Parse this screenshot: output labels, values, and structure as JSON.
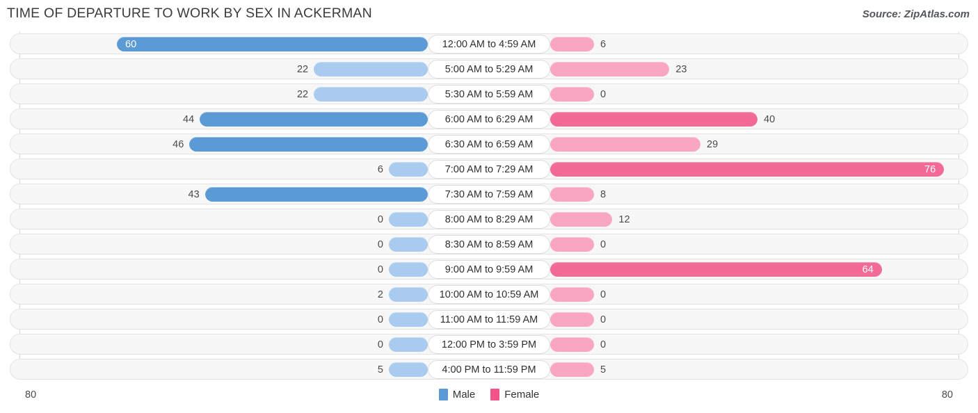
{
  "header": {
    "title": "TIME OF DEPARTURE TO WORK BY SEX IN ACKERMAN",
    "source": "Source: ZipAtlas.com"
  },
  "axis": {
    "left_max": "80",
    "right_max": "80"
  },
  "legend": [
    {
      "label": "Male",
      "color": "#5b9bd5"
    },
    {
      "label": "Female",
      "color": "#f2548a"
    }
  ],
  "chart_data": {
    "type": "bar",
    "orientation": "horizontal-diverging",
    "title": "TIME OF DEPARTURE TO WORK BY SEX IN ACKERMAN",
    "xlabel": "",
    "ylabel": "",
    "xlim": [
      80,
      80
    ],
    "grid": false,
    "legend_position": "bottom-center",
    "categories": [
      "12:00 AM to 4:59 AM",
      "5:00 AM to 5:29 AM",
      "5:30 AM to 5:59 AM",
      "6:00 AM to 6:29 AM",
      "6:30 AM to 6:59 AM",
      "7:00 AM to 7:29 AM",
      "7:30 AM to 7:59 AM",
      "8:00 AM to 8:29 AM",
      "8:30 AM to 8:59 AM",
      "9:00 AM to 9:59 AM",
      "10:00 AM to 10:59 AM",
      "11:00 AM to 11:59 AM",
      "12:00 PM to 3:59 PM",
      "4:00 PM to 11:59 PM"
    ],
    "series": [
      {
        "name": "Male",
        "color": "#5b9bd5",
        "side": "left",
        "values": [
          60,
          22,
          22,
          44,
          46,
          6,
          43,
          0,
          0,
          0,
          2,
          0,
          0,
          5
        ]
      },
      {
        "name": "Female",
        "color": "#f2548a",
        "side": "right",
        "values": [
          6,
          23,
          0,
          40,
          29,
          76,
          8,
          12,
          0,
          64,
          0,
          0,
          0,
          5
        ]
      }
    ]
  }
}
